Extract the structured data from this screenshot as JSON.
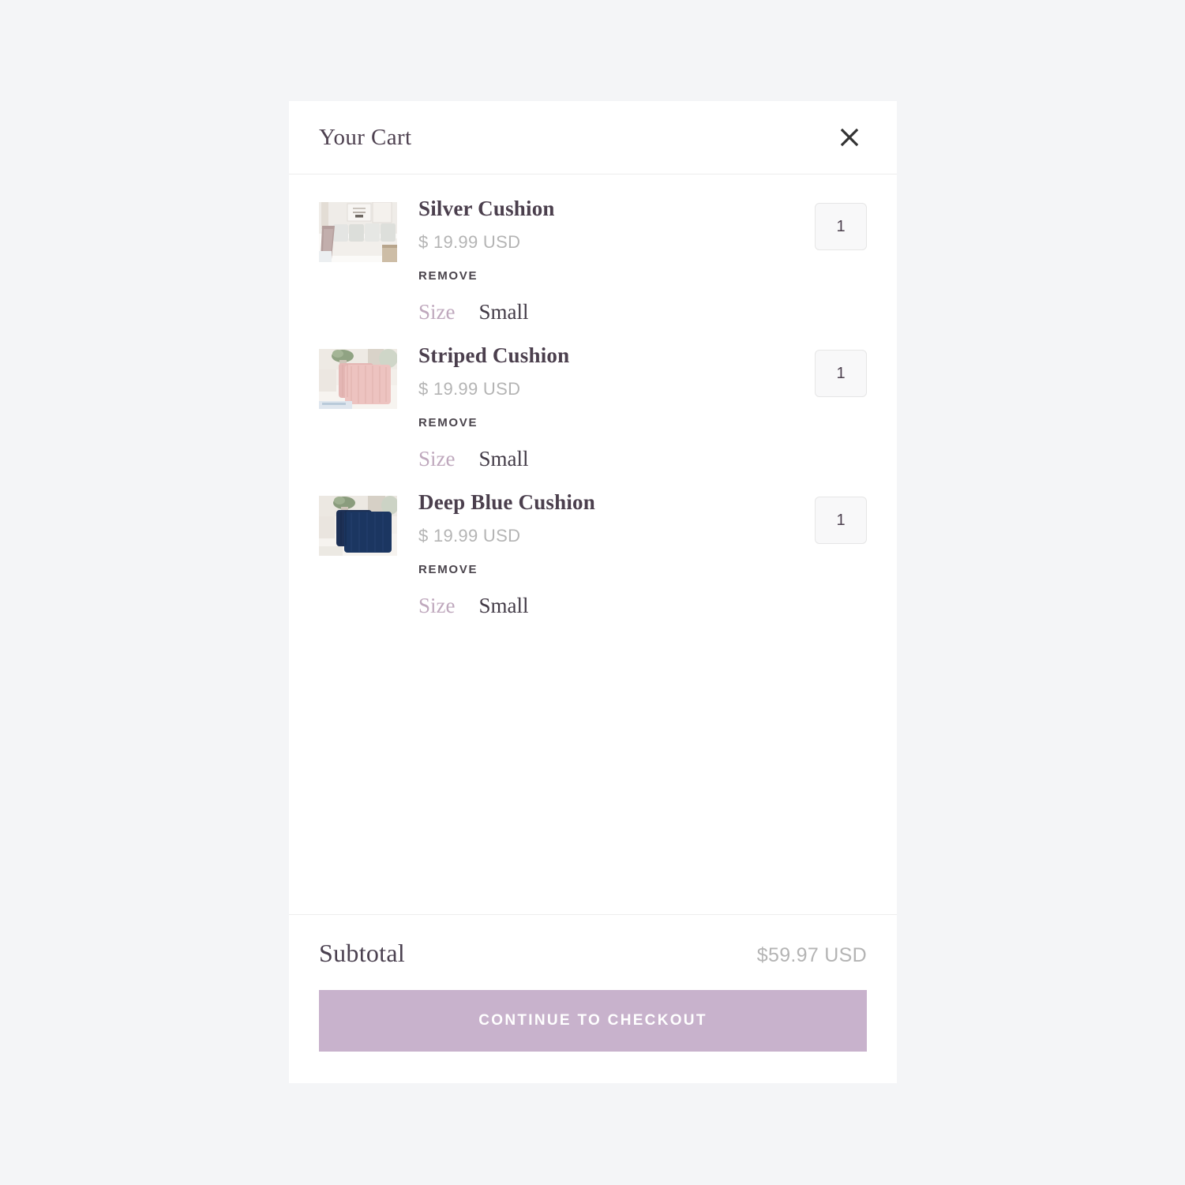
{
  "theme": {
    "page_background": "#f4f5f7",
    "panel_background": "#ffffff",
    "accent": "#c8b2cc",
    "title_color": "#4b3f4d",
    "muted_text": "#b4b4b4",
    "variant_label_color": "#bfa8bd"
  },
  "header": {
    "title": "Your Cart",
    "close_icon": "close-icon"
  },
  "items": [
    {
      "name": "Silver Cushion",
      "price": "$ 19.99 USD",
      "remove_label": "REMOVE",
      "variant_label": "Size",
      "variant_value": "Small",
      "quantity": "1",
      "image_alt": "silver cushions on white sofa"
    },
    {
      "name": "Striped Cushion",
      "price": "$ 19.99 USD",
      "remove_label": "REMOVE",
      "variant_label": "Size",
      "variant_value": "Small",
      "quantity": "1",
      "image_alt": "two pink striped cushions"
    },
    {
      "name": "Deep Blue Cushion",
      "price": "$ 19.99 USD",
      "remove_label": "REMOVE",
      "variant_label": "Size",
      "variant_value": "Small",
      "quantity": "1",
      "image_alt": "two deep blue cushions"
    }
  ],
  "footer": {
    "subtotal_label": "Subtotal",
    "subtotal_value": "$59.97 USD",
    "checkout_label": "CONTINUE TO CHECKOUT"
  }
}
